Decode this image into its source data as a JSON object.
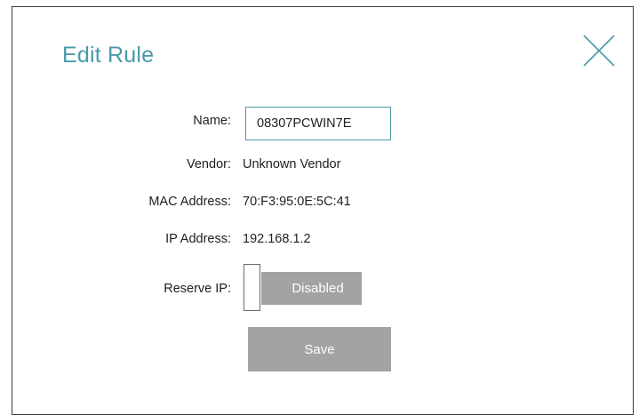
{
  "dialog": {
    "title": "Edit Rule",
    "close_icon": "close-x-icon"
  },
  "fields": {
    "name_label": "Name:",
    "name_value": "08307PCWIN7E",
    "vendor_label": "Vendor:",
    "vendor_value": "Unknown Vendor",
    "mac_label": "MAC Address:",
    "mac_value": "70:F3:95:0E:5C:41",
    "ip_label": "IP Address:",
    "ip_value": "192.168.1.2",
    "reserve_label": "Reserve IP:",
    "reserve_state": "Disabled"
  },
  "actions": {
    "save_label": "Save"
  },
  "colors": {
    "accent": "#4a9aa8",
    "disabled_gray": "#a3a3a3",
    "text": "#1f1f1f"
  }
}
